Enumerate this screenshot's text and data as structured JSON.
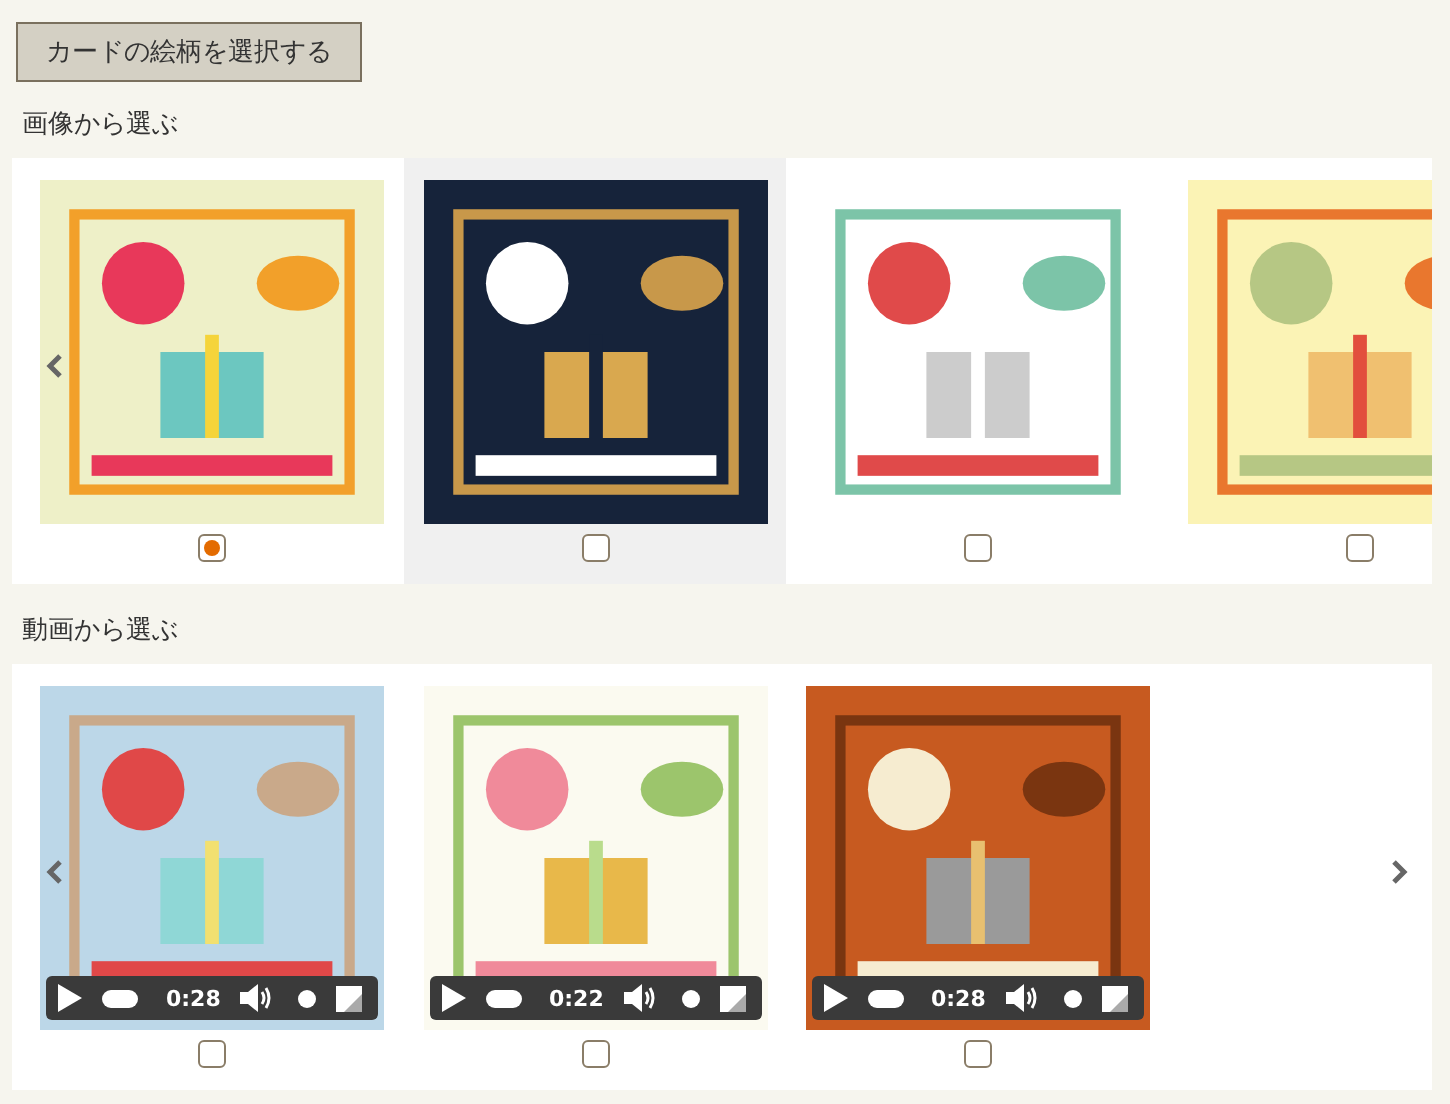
{
  "select_button": {
    "label": "カードの絵柄を選択する"
  },
  "image_section": {
    "heading": "画像から選ぶ",
    "items": [
      {
        "selected": true,
        "highlighted": false
      },
      {
        "selected": false,
        "highlighted": true
      },
      {
        "selected": false,
        "highlighted": false
      },
      {
        "selected": false,
        "highlighted": false
      }
    ]
  },
  "video_section": {
    "heading": "動画から選ぶ",
    "items": [
      {
        "selected": false,
        "time": "0:28",
        "progress": {
          "level": 0
        },
        "volume": {
          "level": 1
        }
      },
      {
        "selected": false,
        "time": "0:22",
        "progress": {
          "level": 0
        },
        "volume": {
          "level": 1
        }
      },
      {
        "selected": false,
        "time": "0:28",
        "progress": {
          "level": 0
        },
        "volume": {
          "level": 1
        }
      }
    ]
  }
}
